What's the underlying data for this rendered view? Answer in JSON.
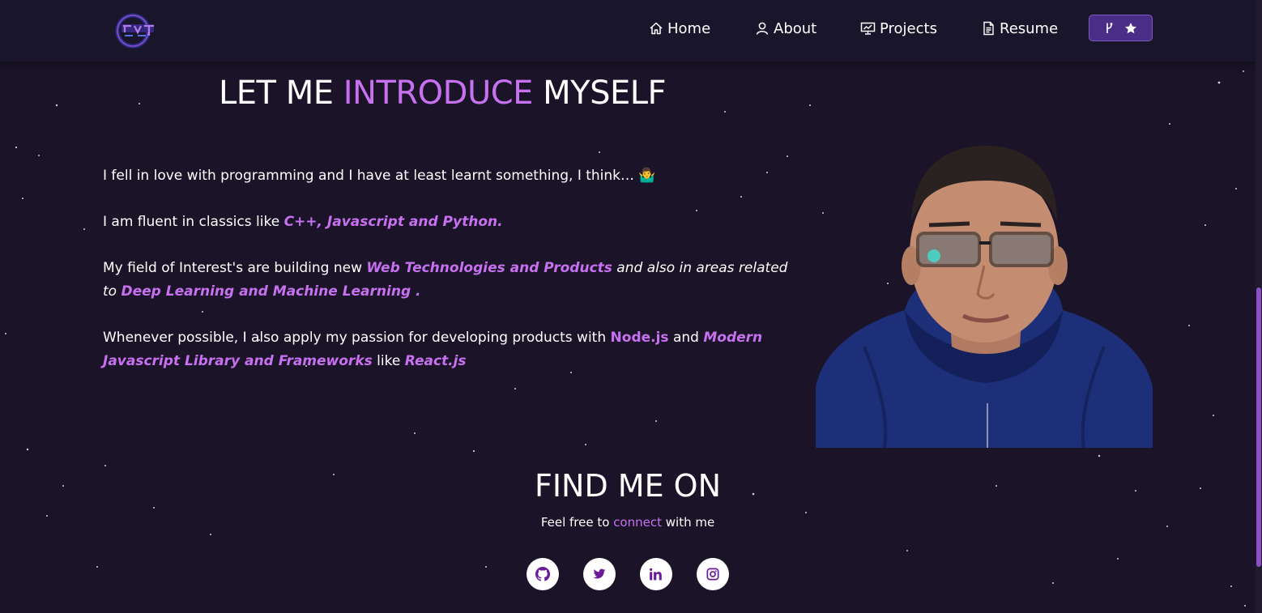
{
  "nav": {
    "logo_alt": "logo",
    "items": [
      {
        "label": "Home",
        "icon": "home-icon"
      },
      {
        "label": "About",
        "icon": "user-icon"
      },
      {
        "label": "Projects",
        "icon": "projects-icon"
      },
      {
        "label": "Resume",
        "icon": "document-icon"
      }
    ],
    "fork_icon": "fork-icon",
    "star_icon": "star-icon"
  },
  "intro": {
    "title_part1": "LET ME ",
    "title_highlight": "INTRODUCE",
    "title_part2": " MYSELF",
    "p1": "I fell in love with programming and I have at least learnt something, I think… 🤷‍♂️",
    "p2_text": "I am fluent in classics like ",
    "p2_highlight": "C++, Javascript and Python.",
    "p3_text": "My field of Interest's are building new ",
    "p3_highlight1": "Web Technologies and Products",
    "p3_mid": " and also in areas related to ",
    "p3_highlight2": "Deep Learning and Machine Learning .",
    "p4_text": "Whenever possible, I also apply my passion for developing products with ",
    "p4_highlight1": "Node.js",
    "p4_mid": " and ",
    "p4_highlight2": "Modern Javascript Library and Frameworks",
    "p4_like": " like ",
    "p4_highlight3": "React.js"
  },
  "find": {
    "title": "FIND ME ON",
    "sub_text": "Feel free to ",
    "sub_link": "connect",
    "sub_end": " with me",
    "socials": [
      "github-icon",
      "twitter-icon",
      "linkedin-icon",
      "instagram-icon"
    ]
  },
  "colors": {
    "background": "#1b1429",
    "navbar": "#19152a",
    "accent": "#c770f0",
    "button": "#4a2d86"
  }
}
